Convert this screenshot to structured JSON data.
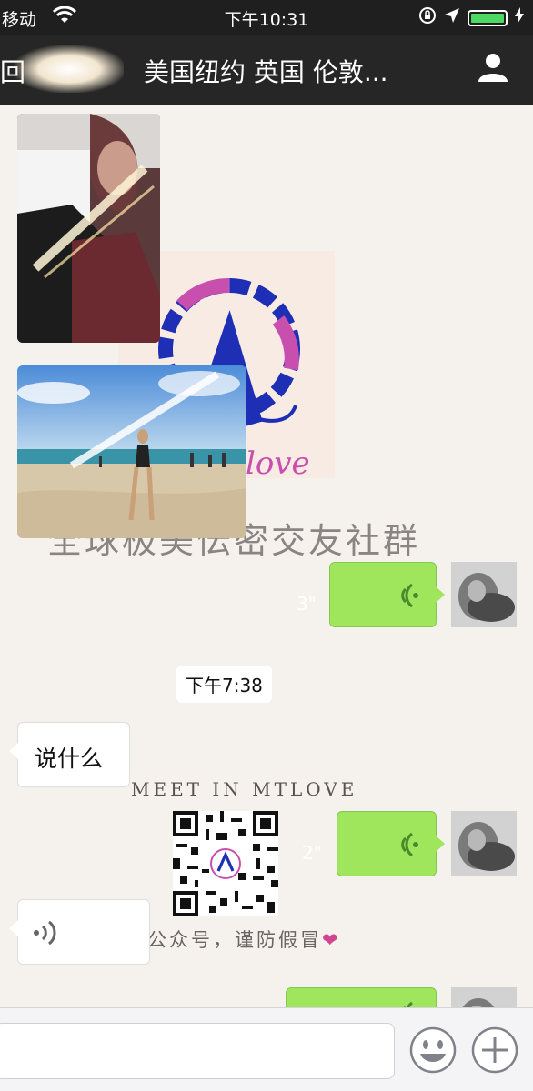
{
  "status_bar": {
    "carrier": "移动",
    "time": "下午10:31",
    "battery_color": "#4cd964"
  },
  "nav": {
    "back_partial": "回",
    "title_visible": "美国纽约 英国 伦敦..."
  },
  "watermark": {
    "partial_text": "全球极美伝密交友社群",
    "logo_text": "love",
    "meet": "MEET IN MTLOVE",
    "gzh_text": "公众号，谨防假冒",
    "heart": "❤"
  },
  "messages": [
    {
      "type": "image",
      "sender": "other",
      "desc": "selfie photo"
    },
    {
      "type": "image",
      "sender": "other",
      "desc": "beach photo"
    },
    {
      "type": "voice",
      "sender": "me",
      "duration": "3\""
    },
    {
      "type": "timestamp",
      "text": "下午7:38"
    },
    {
      "type": "text",
      "sender": "other",
      "text": "说什么"
    },
    {
      "type": "voice",
      "sender": "me",
      "duration": "2\""
    },
    {
      "type": "voice",
      "sender": "other"
    },
    {
      "type": "voice",
      "sender": "me"
    }
  ],
  "colors": {
    "chat_bg": "#f5f1ec",
    "outgoing_bubble": "#9fe65c",
    "nav_bg": "#262626"
  }
}
